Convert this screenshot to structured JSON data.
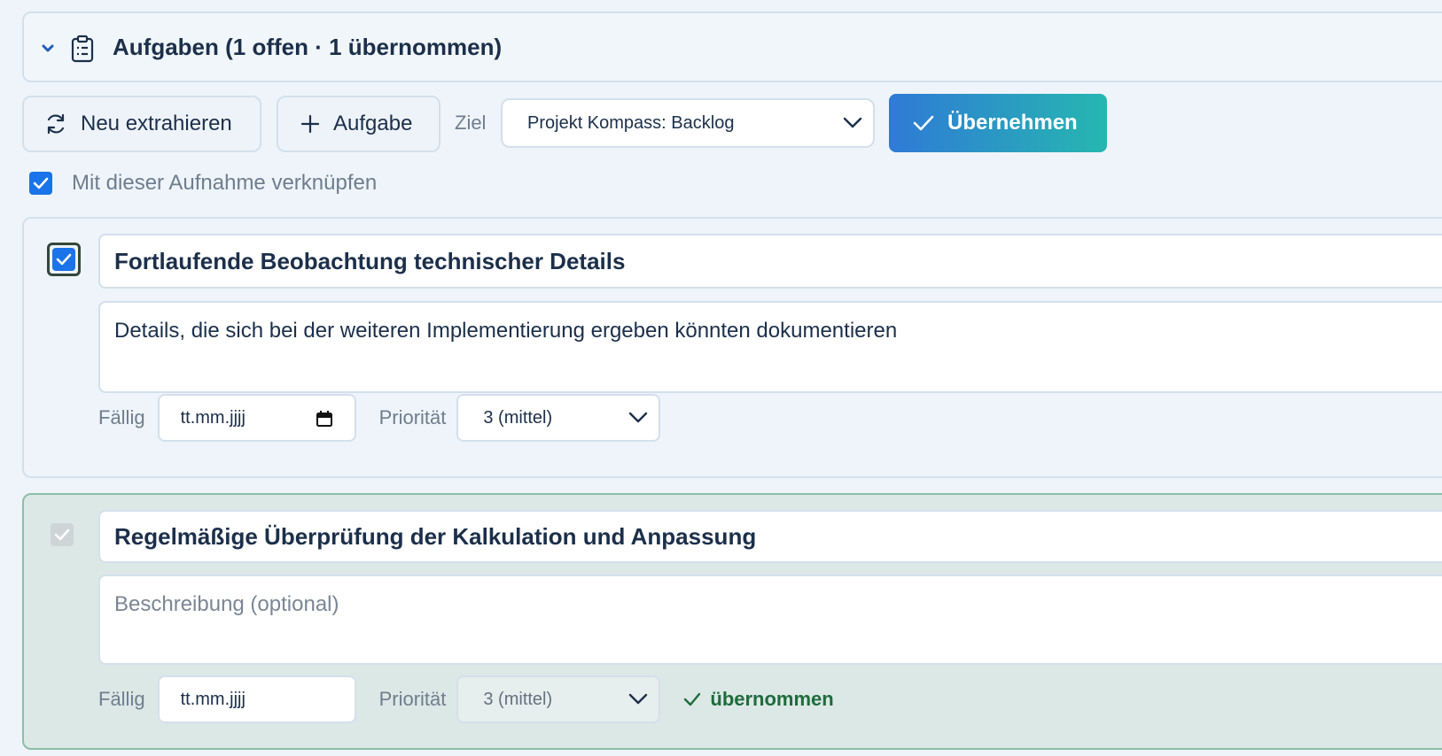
{
  "header": {
    "title": "Aufgaben (1 offen · 1 übernommen)"
  },
  "toolbar": {
    "refresh_label": "Neu extrahieren",
    "add_label": "Aufgabe",
    "target_label": "Ziel",
    "target_value": "Projekt Kompass: Backlog",
    "take_label": "Übernehmen"
  },
  "link_option": {
    "label": "Mit dieser Aufnahme verknüpfen",
    "checked": true
  },
  "tasks": [
    {
      "title": "Fortlaufende Beobachtung technischer Details",
      "description": "Details, die sich bei der weiteren Implementierung ergeben könnten dokumentieren",
      "due_label": "Fällig",
      "due_value": "tt.mm.jjjj",
      "priority_label": "Priorität",
      "priority_value": "3 (mittel)",
      "checked": true
    },
    {
      "title": "Regelmäßige Überprüfung der Kalkulation und Anpassung",
      "description_placeholder": "Beschreibung (optional)",
      "due_label": "Fällig",
      "due_value": "tt.mm.jjjj",
      "priority_label": "Priorität",
      "priority_value": "3 (mittel)",
      "status": "übernommen",
      "checked": true
    }
  ],
  "colors": {
    "accent": "#1a73e8",
    "success": "#1e6b3c",
    "take_gradient_start": "#2f7ad6",
    "take_gradient_end": "#26b7b0"
  }
}
